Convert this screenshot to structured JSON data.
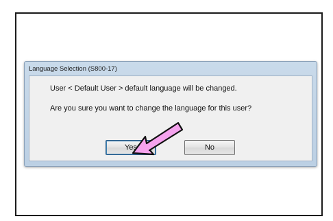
{
  "dialog": {
    "title": "Language Selection (S800-17)",
    "message_line1": "User < Default User > default language will be changed.",
    "message_line2": "Are you sure you want to change the language for this user?",
    "buttons": {
      "yes_label": "Yes",
      "no_label": "No"
    }
  },
  "annotation": {
    "arrow_icon": "pointer-arrow-icon",
    "arrow_fill": "#f5a3ee",
    "arrow_stroke": "#111111"
  }
}
